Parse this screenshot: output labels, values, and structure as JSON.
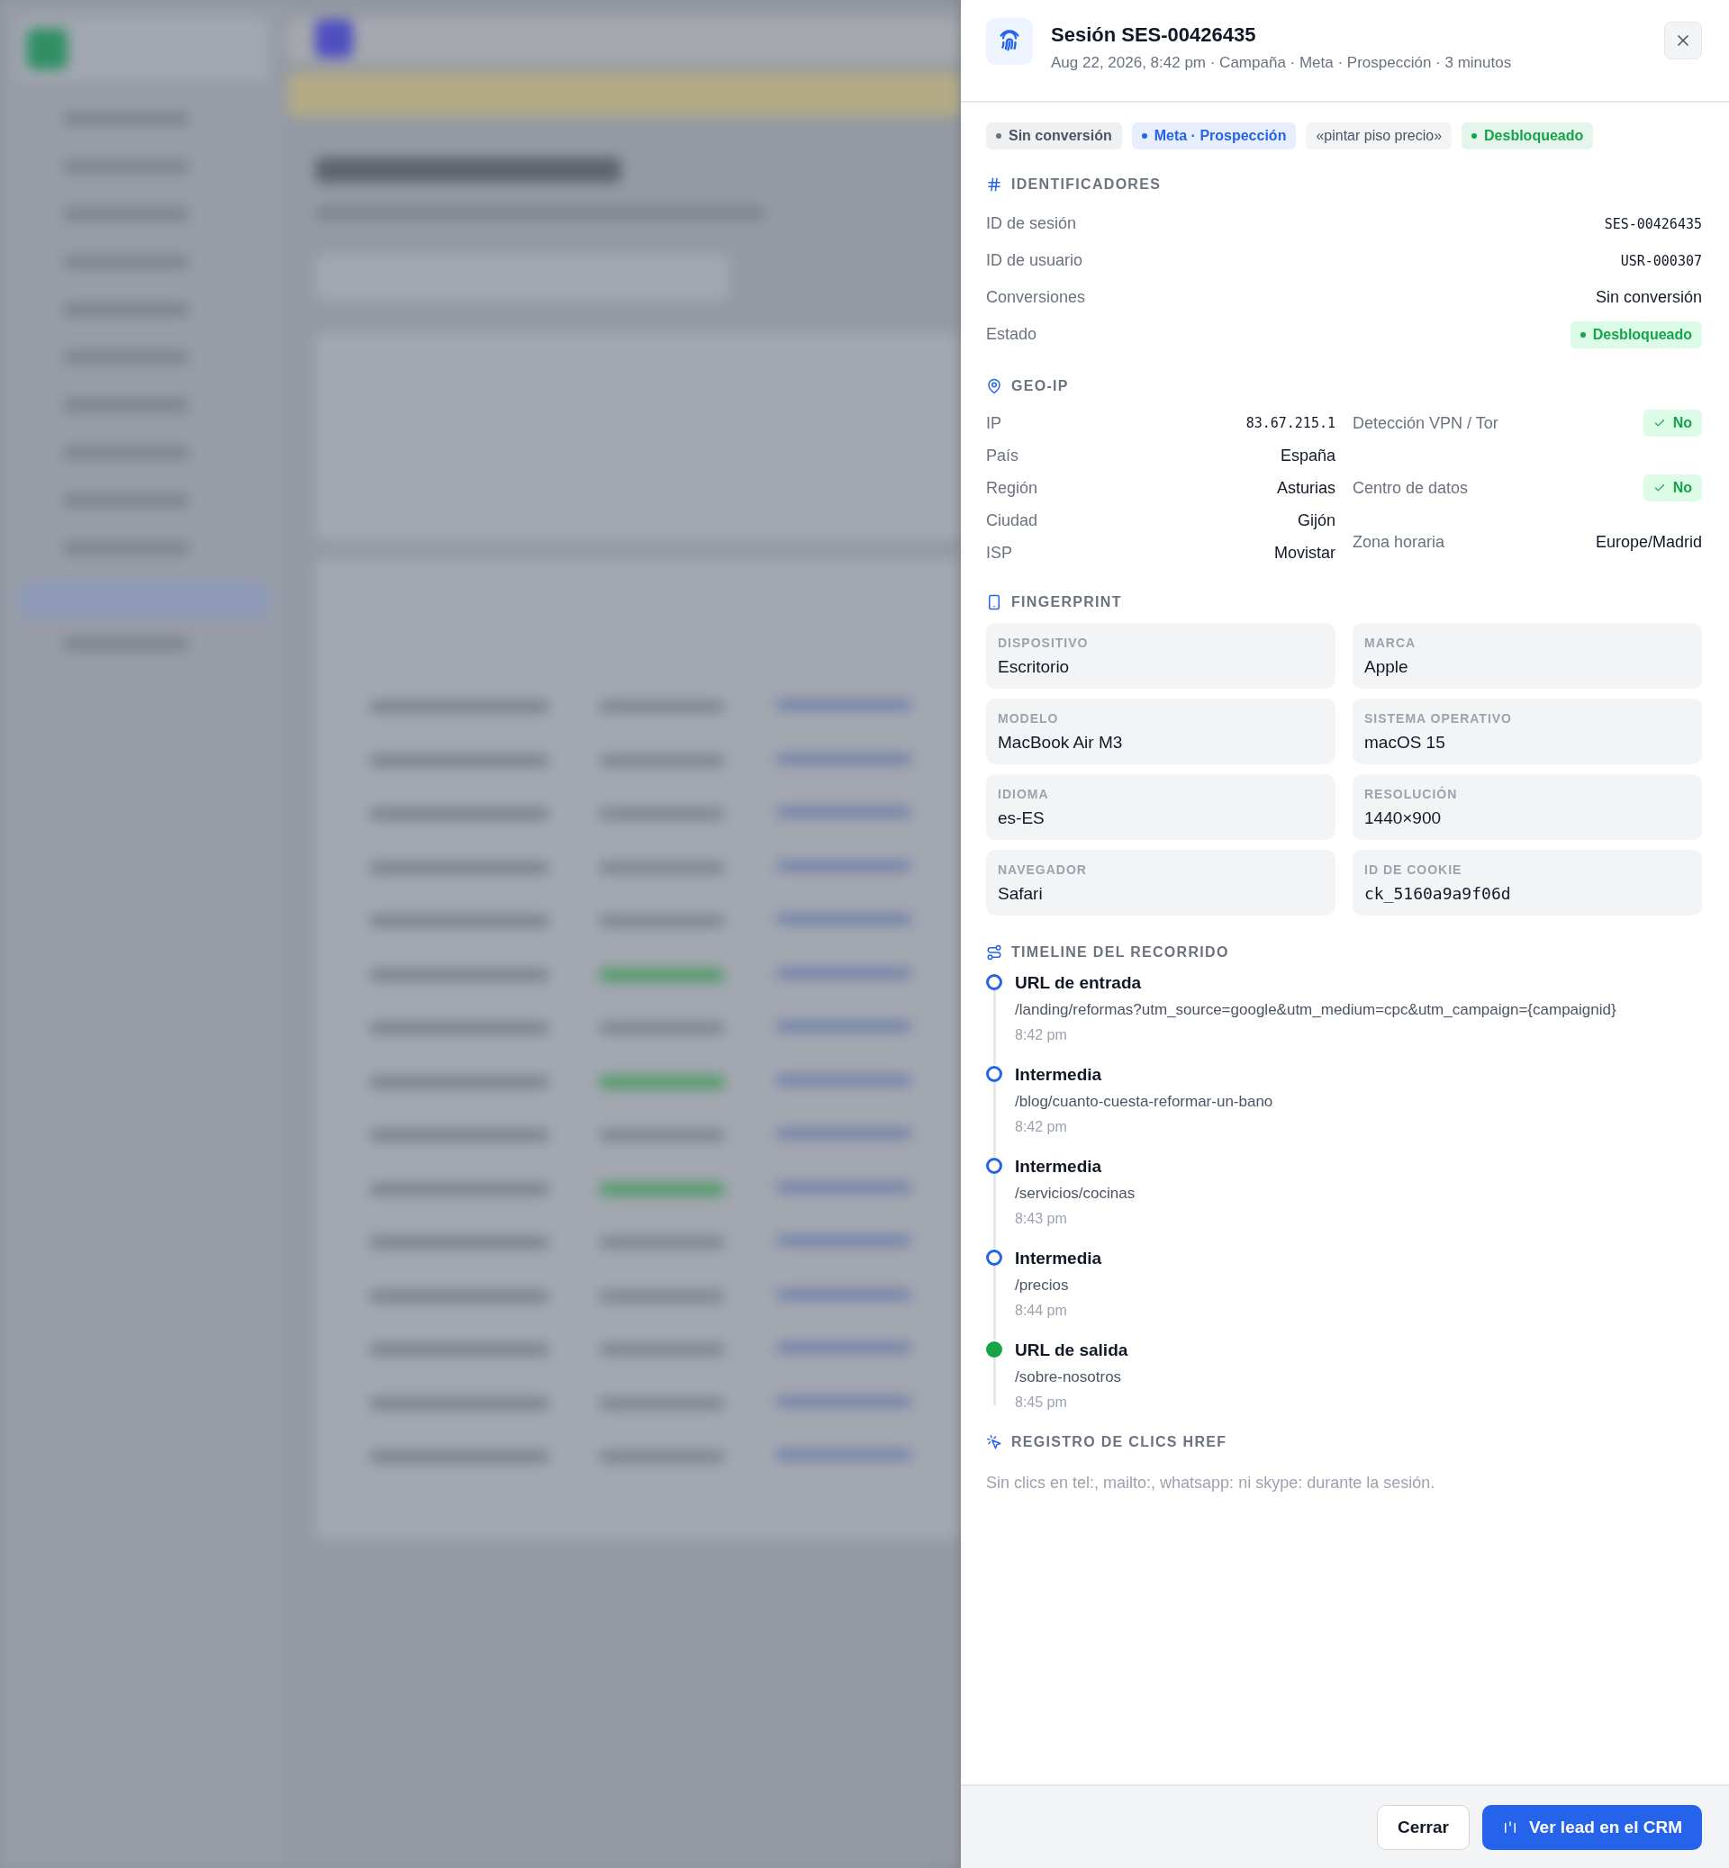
{
  "drawer": {
    "title": "Sesión SES-00426435",
    "subtitle": "Aug 22, 2026, 8:42 pm · Campaña · Meta · Prospección · 3 minutos"
  },
  "tags": [
    {
      "label": "Sin conversión",
      "kind": "dot",
      "color": "#6b7280"
    },
    {
      "label": "Meta · Prospección",
      "kind": "dot",
      "color": "#2563eb"
    },
    {
      "label": "«pintar piso precio»",
      "kind": "plain"
    },
    {
      "label": "Desbloqueado",
      "kind": "dot",
      "color": "#16a34a"
    }
  ],
  "identifiers": {
    "title": "IDENTIFICADORES",
    "rows": [
      {
        "label": "ID de sesión",
        "value": "SES-00426435",
        "kind": "mono"
      },
      {
        "label": "ID de usuario",
        "value": "USR-000307",
        "kind": "mono"
      },
      {
        "label": "Conversiones",
        "value": "Sin conversión",
        "kind": "text"
      },
      {
        "label": "Estado",
        "value": "Desbloqueado",
        "kind": "badge"
      }
    ]
  },
  "geo_ip": {
    "title": "GEO-IP",
    "left": [
      {
        "label": "IP",
        "value": "83.67.215.1",
        "kind": "mono"
      },
      {
        "label": "País",
        "value": "España",
        "kind": "text"
      },
      {
        "label": "Región",
        "value": "Asturias",
        "kind": "text"
      },
      {
        "label": "Ciudad",
        "value": "Gijón",
        "kind": "text"
      },
      {
        "label": "ISP",
        "value": "Movistar",
        "kind": "text"
      }
    ],
    "right": [
      {
        "label": "Detección VPN / Tor",
        "value": "No",
        "kind": "check"
      },
      {
        "label": "Centro de datos",
        "value": "No",
        "kind": "check"
      },
      {
        "label": "Zona horaria",
        "value": "Europe/Madrid",
        "kind": "text"
      }
    ]
  },
  "fingerprint": {
    "title": "FINGERPRINT",
    "cards": [
      {
        "label": "DISPOSITIVO",
        "value": "Escritorio",
        "kind": "text"
      },
      {
        "label": "MARCA",
        "value": "Apple",
        "kind": "text"
      },
      {
        "label": "MODELO",
        "value": "MacBook Air M3",
        "kind": "text"
      },
      {
        "label": "SISTEMA OPERATIVO",
        "value": "macOS 15",
        "kind": "text"
      },
      {
        "label": "IDIOMA",
        "value": "es-ES",
        "kind": "text"
      },
      {
        "label": "RESOLUCIÓN",
        "value": "1440×900",
        "kind": "text"
      },
      {
        "label": "NAVEGADOR",
        "value": "Safari",
        "kind": "text"
      },
      {
        "label": "ID DE COOKIE",
        "value": "ck_5160a9a9f06d",
        "kind": "mono"
      }
    ]
  },
  "timeline": {
    "title": "TIMELINE DEL RECORRIDO",
    "steps": [
      {
        "title": "URL de entrada",
        "path": "/landing/reformas?utm_source=google&utm_medium=cpc&utm_campaign={campaignid}",
        "time": "8:42 pm",
        "kind": "step"
      },
      {
        "title": "Intermedia",
        "path": "/blog/cuanto-cuesta-reformar-un-bano",
        "time": "8:42 pm",
        "kind": "step"
      },
      {
        "title": "Intermedia",
        "path": "/servicios/cocinas",
        "time": "8:43 pm",
        "kind": "step"
      },
      {
        "title": "Intermedia",
        "path": "/precios",
        "time": "8:44 pm",
        "kind": "step"
      },
      {
        "title": "URL de salida",
        "path": "/sobre-nosotros",
        "time": "8:45 pm",
        "kind": "exit"
      }
    ]
  },
  "href_clicks": {
    "title": "REGISTRO DE CLICS HREF",
    "empty_text": "Sin clics en tel:, mailto:, whatsapp: ni skype: durante la sesión."
  },
  "footer": {
    "buttons": [
      {
        "label": "Cerrar",
        "kind": "secondary"
      },
      {
        "label": "Ver lead en el CRM",
        "kind": "primary"
      }
    ]
  }
}
